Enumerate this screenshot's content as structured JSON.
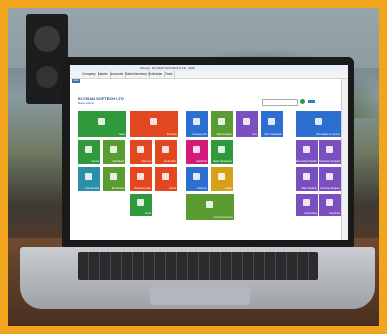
{
  "app": {
    "window_title": "Shreeji · ELYSIAN SOFTECH LTD - ERP",
    "menus": [
      "Company",
      "Master",
      "Accounts",
      "Sales/Inventory",
      "Schedular",
      "Tools"
    ],
    "help_label": "Help",
    "company_name": "ELYSIAN SOFTECH LTD",
    "subtitle": "Ravi+Admin"
  },
  "tiles": [
    {
      "id": "sales",
      "label": "Sales",
      "color": "#2e9a3b"
    },
    {
      "id": "purchase",
      "label": "Purchase",
      "color": "#e3471f"
    },
    {
      "id": "company-info",
      "label": "Company Info",
      "color": "#2c6fd1"
    },
    {
      "id": "sales-register",
      "label": "Sales Register",
      "color": "#5a9c32"
    },
    {
      "id": "item",
      "label": "Item",
      "color": "#7b4fbf"
    },
    {
      "id": "item-transaction",
      "label": "Item Transaction",
      "color": "#2c6fd1"
    },
    {
      "id": "receivable-vs-income",
      "label": "Receivable vs Income",
      "color": "#2c6fd1"
    },
    {
      "id": "journal",
      "label": "Journal",
      "color": "#2e9a3b"
    },
    {
      "id": "cash-book",
      "label": "Cash Book",
      "color": "#5a9c32"
    },
    {
      "id": "payment",
      "label": "Payment",
      "color": "#e3471f"
    },
    {
      "id": "credit-note",
      "label": "Credit Note",
      "color": "#e3471f"
    },
    {
      "id": "cashbook",
      "label": "Cashbook",
      "color": "#d41a7a"
    },
    {
      "id": "bank-transaction",
      "label": "Bank Transaction",
      "color": "#2e9a3b"
    },
    {
      "id": "receivable-payable",
      "label": "Receivable Payable",
      "color": "#7b4fbf"
    },
    {
      "id": "transaction-analysis",
      "label": "Transaction Analysis",
      "color": "#7b4fbf"
    },
    {
      "id": "cash-receipt",
      "label": "Cash Receipt",
      "color": "#2a8fa8"
    },
    {
      "id": "bill-receipt",
      "label": "Bill Receipt",
      "color": "#5a9c32"
    },
    {
      "id": "bank-reconcile",
      "label": "Bank Reconcile",
      "color": "#e3471f"
    },
    {
      "id": "contra",
      "label": "Contra",
      "color": "#e3471f"
    },
    {
      "id": "customer",
      "label": "Customer",
      "color": "#2c6fd1"
    },
    {
      "id": "ledger",
      "label": "Ledger",
      "color": "#d6a01b"
    },
    {
      "id": "sales-register-2",
      "label": "Sales Register",
      "color": "#7b4fbf"
    },
    {
      "id": "purchase-register",
      "label": "Purchase Register",
      "color": "#7b4fbf"
    },
    {
      "id": "stock",
      "label": "Stock",
      "color": "#2e9a3b"
    },
    {
      "id": "account-summary",
      "label": "Account Summary",
      "color": "#5a9c32"
    },
    {
      "id": "outstanding",
      "label": "Outstanding",
      "color": "#7b4fbf"
    },
    {
      "id": "day-book",
      "label": "Day Book",
      "color": "#7b4fbf"
    }
  ]
}
